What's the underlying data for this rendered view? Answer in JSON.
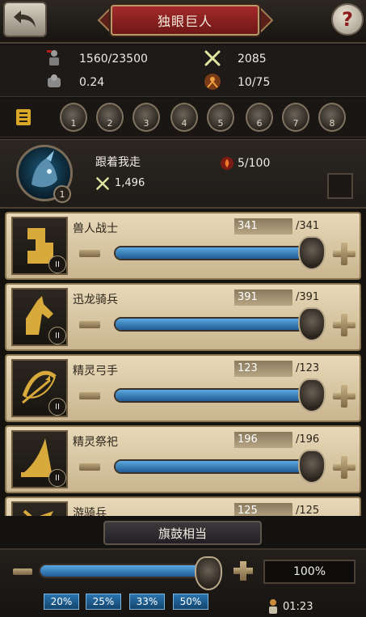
{
  "header": {
    "title": "独眼巨人"
  },
  "stats": {
    "troops": "1560/23500",
    "power": "2085",
    "ratio": "0.24",
    "formations": "10/75"
  },
  "slots": [
    "1",
    "2",
    "3",
    "4",
    "5",
    "6",
    "7",
    "8"
  ],
  "hero": {
    "name": "跟着我走",
    "level": "1",
    "power": "1,496",
    "stamina": "5/100"
  },
  "troops": [
    {
      "name": "兽人战士",
      "count": "341",
      "max": "/341",
      "tier": "II",
      "fill": 1.0
    },
    {
      "name": "迅龙骑兵",
      "count": "391",
      "max": "/391",
      "tier": "II",
      "fill": 1.0
    },
    {
      "name": "精灵弓手",
      "count": "123",
      "max": "/123",
      "tier": "II",
      "fill": 1.0
    },
    {
      "name": "精灵祭祀",
      "count": "196",
      "max": "/196",
      "tier": "II",
      "fill": 1.0
    },
    {
      "name": "游骑兵",
      "count": "125",
      "max": "/125",
      "tier": "II",
      "fill": 1.0
    }
  ],
  "formation": {
    "label": "旗鼓相当"
  },
  "bottom": {
    "percent": "100%",
    "fill": 1.0,
    "presets": [
      "20%",
      "25%",
      "33%",
      "50%"
    ],
    "timer": "01:23"
  },
  "colors": {
    "accent": "#a42a2a",
    "slider": "#3b86c6",
    "parchment": "#dccaa5"
  }
}
